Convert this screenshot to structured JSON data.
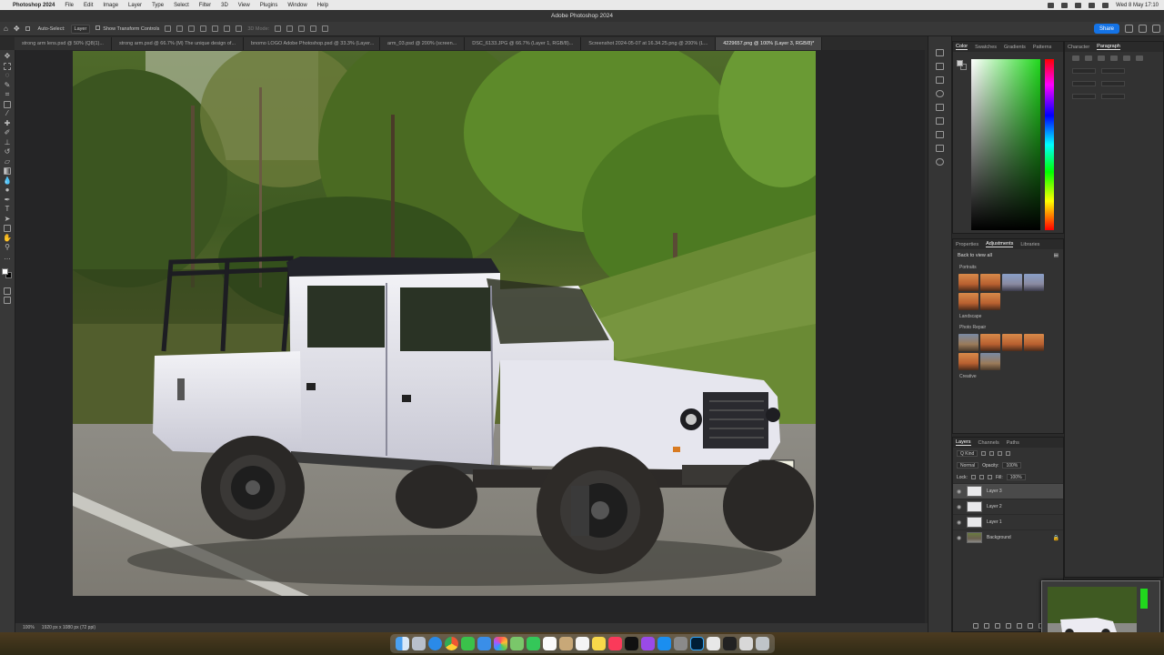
{
  "menubar": {
    "apple": "",
    "items": [
      "Photoshop 2024",
      "File",
      "Edit",
      "Image",
      "Layer",
      "Type",
      "Select",
      "Filter",
      "3D",
      "View",
      "Plugins",
      "Window",
      "Help"
    ],
    "clock": "Wed 8 May  17:10"
  },
  "window": {
    "title": "Adobe Photoshop 2024"
  },
  "options": {
    "auto_select_label": "Auto-Select:",
    "auto_select_value": "Layer",
    "transform_label": "Show Transform Controls",
    "mode_3d": "3D Mode:",
    "share_label": "Share"
  },
  "tabs": [
    {
      "label": "strong arm lens.psd @ 50% (Q8(1)..."
    },
    {
      "label": "strong arm.psd @ 66.7% (M) The unique design of..."
    },
    {
      "label": "bnomo LOGO Adobe Photoshop.psd @ 33.3% (Layer..."
    },
    {
      "label": "arm_03.psd @ 200% (screen..."
    },
    {
      "label": "DSC_6133.JPG @ 66.7% (Layer 1, RGB/8)..."
    },
    {
      "label": "Screenshot 2024-05-07 at 16.34.25.png @ 200% (L..."
    },
    {
      "label": "4229657.png @ 100% (Layer 3, RGB/8)*",
      "active": true
    }
  ],
  "status": {
    "zoom": "100%",
    "doc_size": "1920 px x 1080 px (72 ppi)"
  },
  "color_panel": {
    "tabs": [
      "Color",
      "Swatches",
      "Gradients",
      "Patterns"
    ],
    "selected_hue": "#21d81d"
  },
  "char_panel": {
    "tabs": [
      "Character",
      "Paragraph"
    ]
  },
  "adjust_panel": {
    "tabs": [
      "Properties",
      "Adjustments",
      "Libraries"
    ],
    "back_label": "Back to view all",
    "sections": [
      "Portraits",
      "Landscape",
      "Photo Repair",
      "Creative"
    ]
  },
  "layers_panel": {
    "tabs": [
      "Layers",
      "Channels",
      "Paths"
    ],
    "kind_label": "Q Kind",
    "blend_mode": "Normal",
    "opacity_label": "Opacity:",
    "opacity": "100%",
    "lock_label": "Lock:",
    "fill_label": "Fill:",
    "fill": "100%",
    "layers": [
      {
        "name": "Layer 3",
        "selected": true
      },
      {
        "name": "Layer 2"
      },
      {
        "name": "Layer 1"
      },
      {
        "name": "Background",
        "locked": true
      }
    ]
  },
  "dock": {
    "apps": [
      "finder",
      "launchpad",
      "safari",
      "chrome",
      "messages",
      "mail",
      "photos",
      "maps",
      "facetime",
      "calendar",
      "contacts",
      "reminders",
      "notes",
      "music",
      "tv",
      "podcasts",
      "app-store",
      "settings",
      "photoshop",
      "preview",
      "terminal",
      "finder-2",
      "trash"
    ]
  }
}
